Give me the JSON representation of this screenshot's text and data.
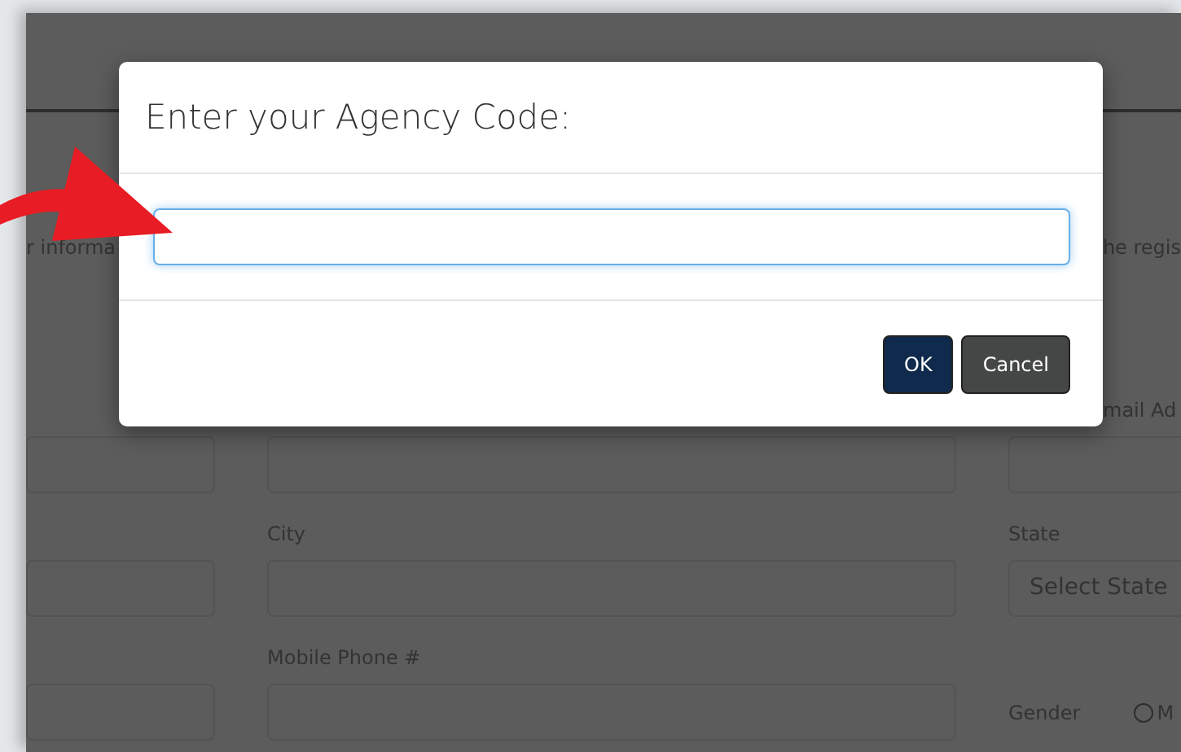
{
  "page": {
    "intro_left": "r informa",
    "intro_right": "he regis",
    "rows": [
      {
        "cells": [
          {
            "kind": "input"
          },
          {
            "kind": "input"
          },
          {
            "kind": "input",
            "label": "mail Ad"
          }
        ]
      },
      {
        "cells": [
          {
            "kind": "input"
          },
          {
            "kind": "input",
            "label": "City"
          },
          {
            "kind": "select",
            "label": "State",
            "value": "Select State"
          }
        ]
      },
      {
        "cells": [
          {
            "kind": "input"
          },
          {
            "kind": "input",
            "label": "Mobile Phone #"
          },
          {
            "kind": "radio",
            "label": "Gender",
            "options": [
              {
                "label": "M",
                "selected": false
              }
            ]
          }
        ]
      }
    ]
  },
  "dialog": {
    "title": "Enter your Agency Code:",
    "buttons": [
      {
        "label": "OK",
        "kind": "primary"
      },
      {
        "label": "Cancel",
        "kind": "secondary"
      }
    ]
  }
}
